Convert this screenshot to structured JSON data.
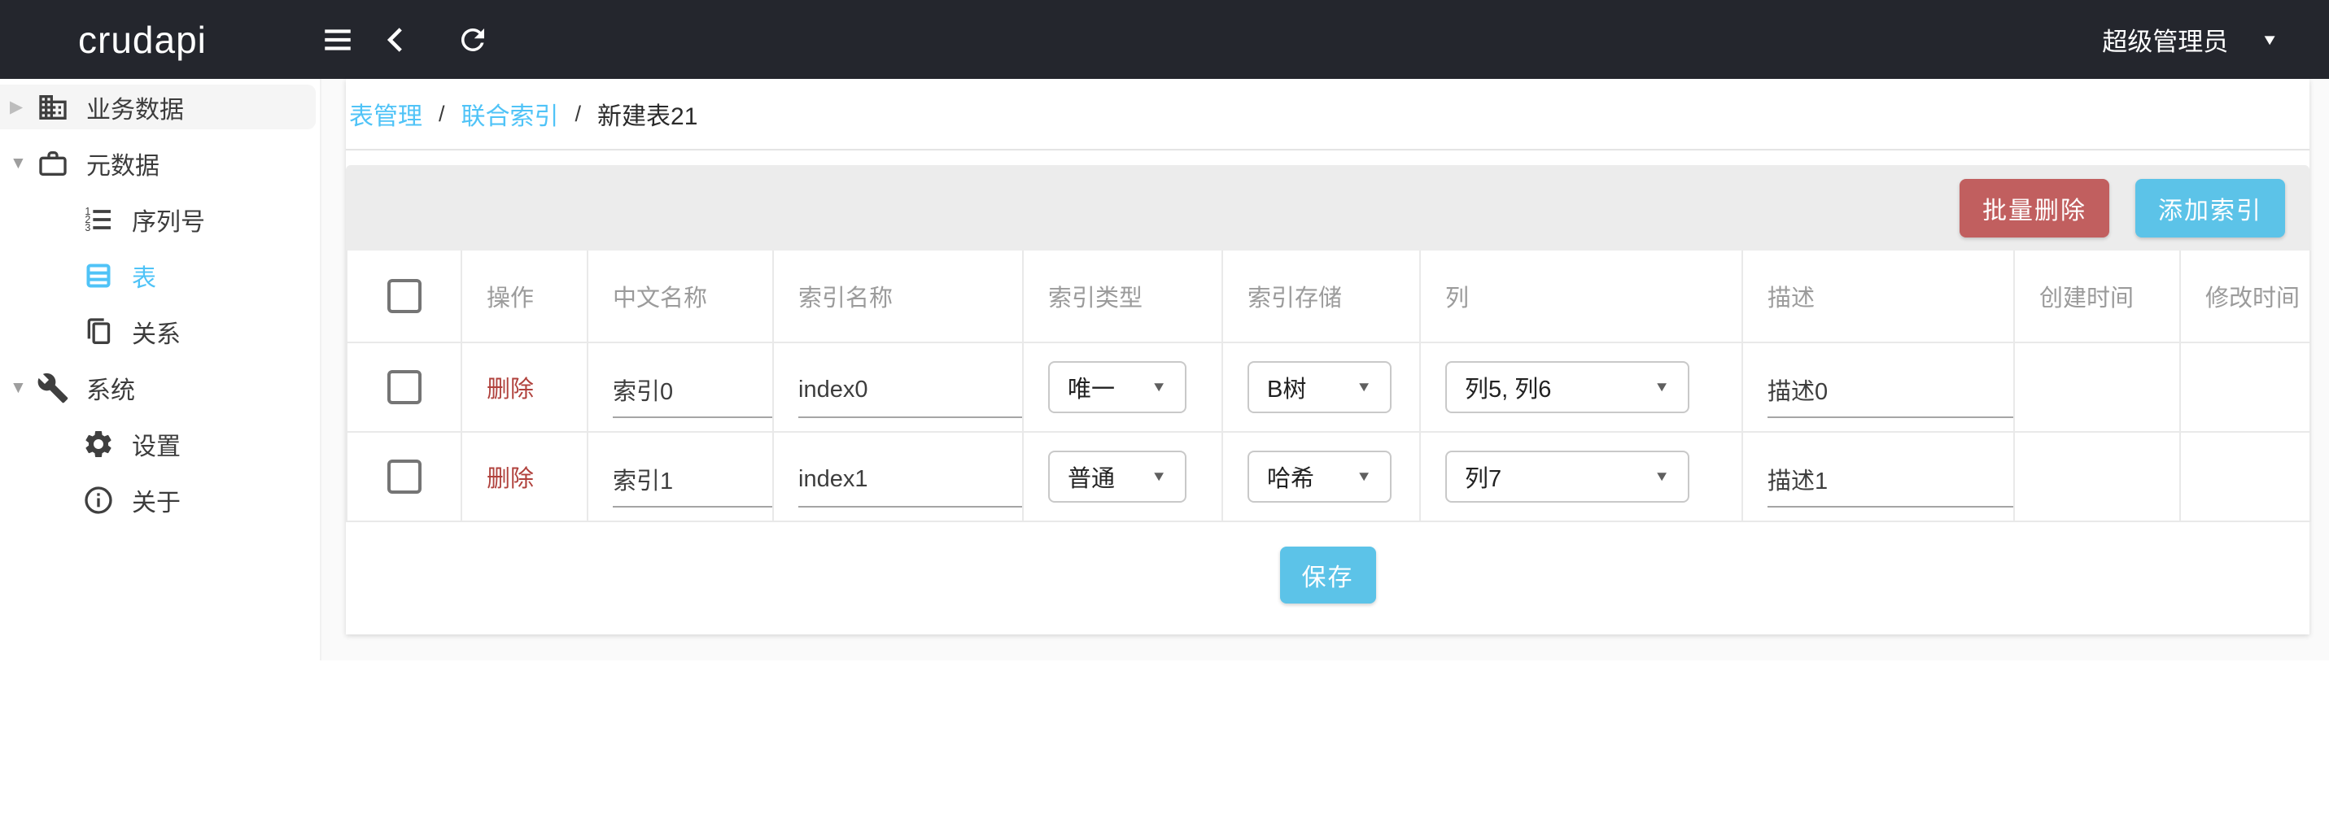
{
  "header": {
    "logo": "crudapi",
    "user_menu": {
      "label": "超级管理员"
    }
  },
  "sidebar": {
    "items": [
      {
        "label": "业务数据"
      },
      {
        "label": "元数据"
      },
      {
        "label": "序列号"
      },
      {
        "label": "表"
      },
      {
        "label": "关系"
      },
      {
        "label": "系统"
      },
      {
        "label": "设置"
      },
      {
        "label": "关于"
      }
    ]
  },
  "breadcrumb": {
    "separator": "/",
    "items": [
      {
        "label": "表管理"
      },
      {
        "label": "联合索引"
      },
      {
        "label": "新建表21"
      }
    ]
  },
  "toolbar": {
    "batch_delete": "批量删除",
    "add_index": "添加索引"
  },
  "table": {
    "headers": {
      "action": "操作",
      "name": "中文名称",
      "index_name": "索引名称",
      "index_type": "索引类型",
      "index_storage": "索引存储",
      "columns": "列",
      "description": "描述",
      "created": "创建时间",
      "modified": "修改时间"
    },
    "rows": [
      {
        "action": "删除",
        "name": "索引0",
        "index_name": "index0",
        "index_type": "唯一",
        "index_storage": "B树",
        "columns": "列5, 列6",
        "description": "描述0",
        "created": "",
        "modified": ""
      },
      {
        "action": "删除",
        "name": "索引1",
        "index_name": "index1",
        "index_type": "普通",
        "index_storage": "哈希",
        "columns": "列7",
        "description": "描述1",
        "created": "",
        "modified": ""
      }
    ]
  },
  "footer": {
    "save": "保存"
  },
  "colors": {
    "header_bg": "#24262d",
    "accent_blue": "#4fc3f7",
    "button_blue": "#5cc3e8",
    "button_red": "#c15f5f",
    "delete_link_red": "#b0413c",
    "toolbar_bg": "#ececec"
  }
}
